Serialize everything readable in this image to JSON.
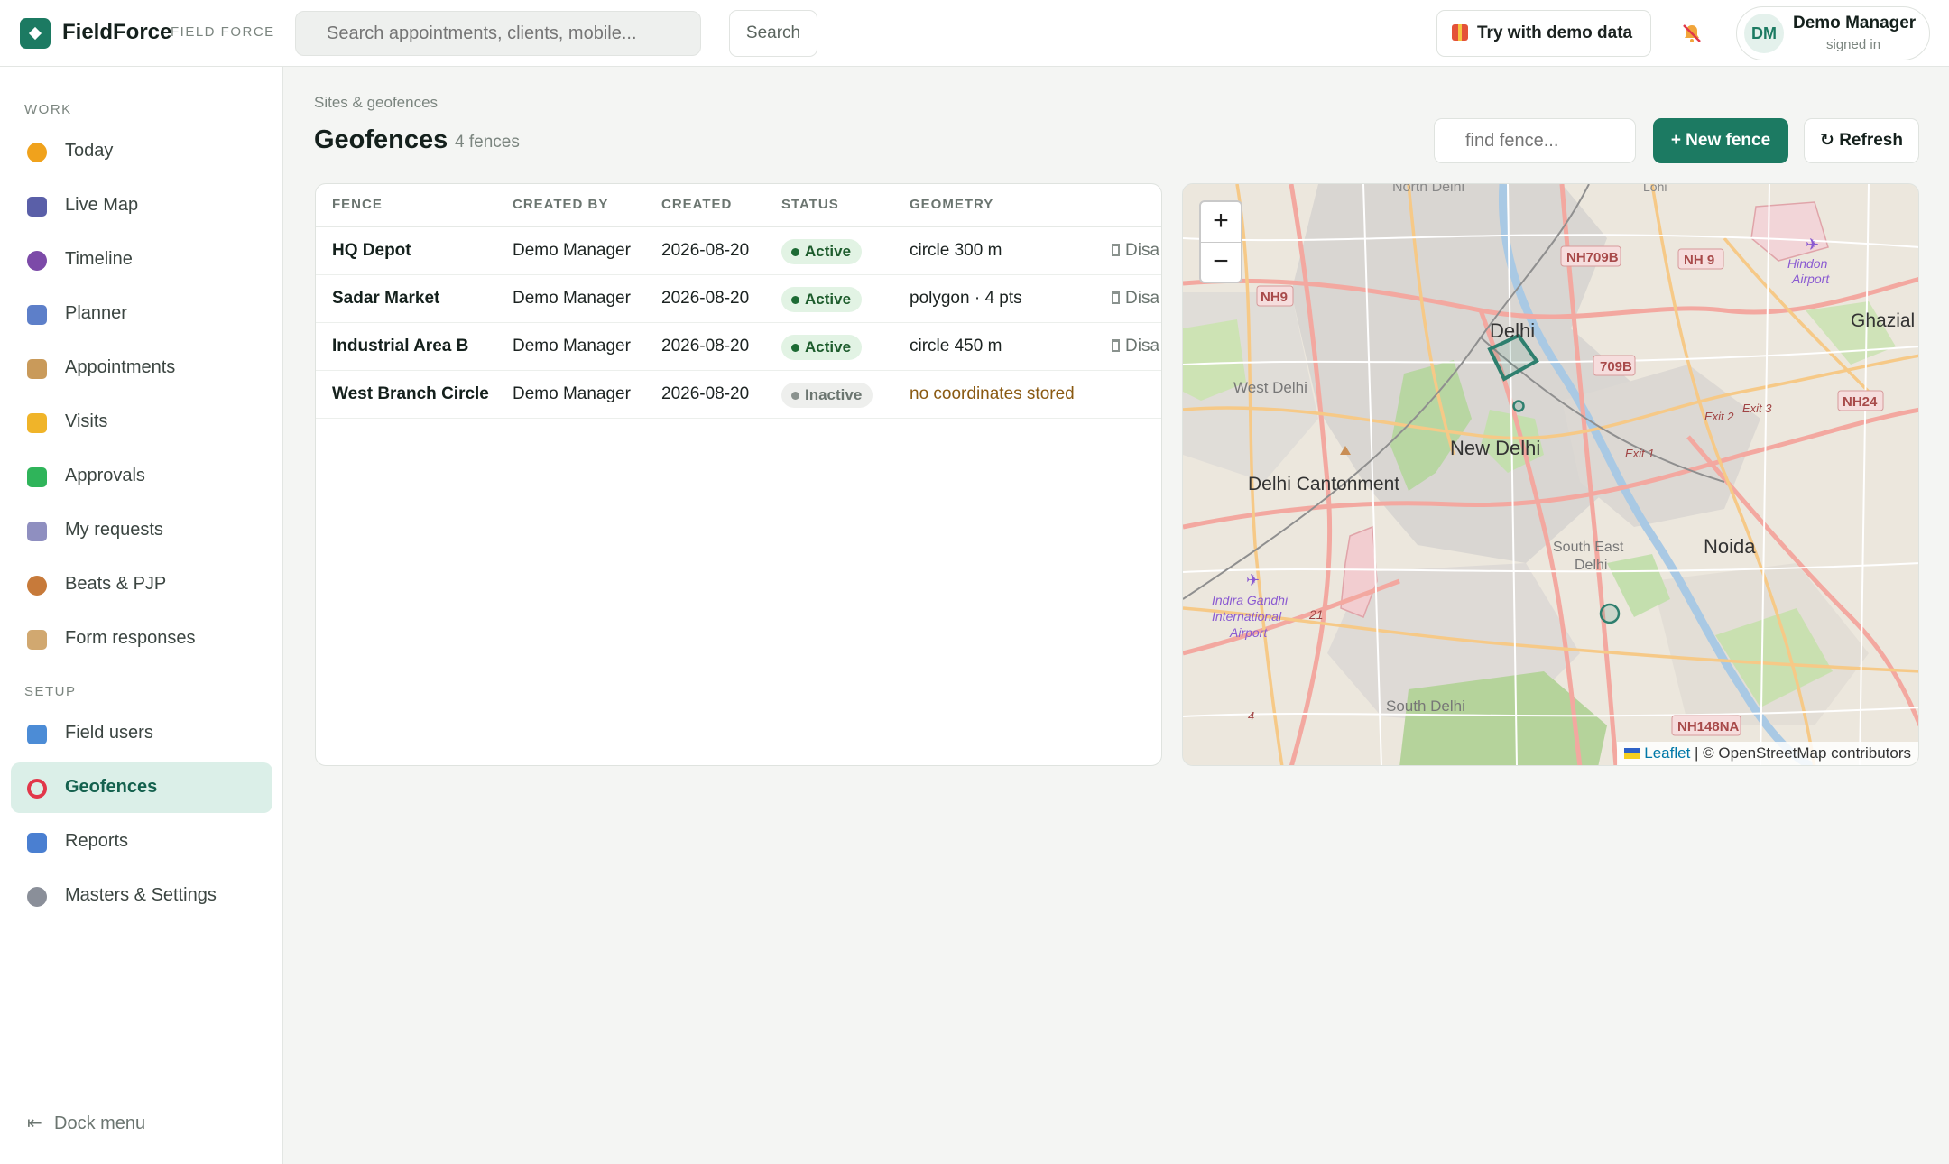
{
  "header": {
    "brand": "FieldForce",
    "brand_sub": "FIELD FORCE",
    "search_placeholder": "Search appointments, clients, mobile...",
    "search_button": "Search",
    "demo_button": "Try with demo data",
    "user_initials": "DM",
    "user_name": "Demo Manager",
    "user_status": "signed in"
  },
  "sidebar": {
    "work_label": "WORK",
    "setup_label": "SETUP",
    "work_items": [
      {
        "label": "Today",
        "icon": "sun-icon",
        "color": "#f0a21c"
      },
      {
        "label": "Live Map",
        "icon": "satellite-icon",
        "color": "#5a5fa8"
      },
      {
        "label": "Timeline",
        "icon": "stopwatch-icon",
        "color": "#7c4aa8"
      },
      {
        "label": "Planner",
        "icon": "calendar-icon",
        "color": "#5d7fc9"
      },
      {
        "label": "Appointments",
        "icon": "clipboard-icon",
        "color": "#c99a5a"
      },
      {
        "label": "Visits",
        "icon": "handshake-icon",
        "color": "#f0b429"
      },
      {
        "label": "Approvals",
        "icon": "check-box-icon",
        "color": "#2fb45a"
      },
      {
        "label": "My requests",
        "icon": "receipt-icon",
        "color": "#8f8fc0"
      },
      {
        "label": "Beats & PJP",
        "icon": "compass-icon",
        "color": "#c77a3a"
      },
      {
        "label": "Form responses",
        "icon": "clipboard-icon",
        "color": "#d1a870"
      }
    ],
    "setup_items": [
      {
        "label": "Field users",
        "icon": "id-card-icon",
        "color": "#4c8cd6"
      },
      {
        "label": "Geofences",
        "icon": "ring-icon",
        "color": "#e2374a"
      },
      {
        "label": "Reports",
        "icon": "bar-chart-icon",
        "color": "#4a7fd1"
      },
      {
        "label": "Masters & Settings",
        "icon": "gear-icon",
        "color": "#8a8f99"
      }
    ],
    "dock_label": "Dock menu"
  },
  "main": {
    "breadcrumb": "Sites & geofences",
    "title": "Geofences",
    "count": "4 fences",
    "find_placeholder": "find fence...",
    "new_button": "+ New fence",
    "refresh_button": "↻ Refresh",
    "columns": [
      "FENCE",
      "CREATED BY",
      "CREATED",
      "STATUS",
      "GEOMETRY"
    ],
    "rows": [
      {
        "fence": "HQ Depot",
        "created_by": "Demo Manager",
        "created": "2026-08-20",
        "status": "Active",
        "geometry": "circle 300 m",
        "action": "Disa"
      },
      {
        "fence": "Sadar Market",
        "created_by": "Demo Manager",
        "created": "2026-08-20",
        "status": "Active",
        "geometry": "polygon · 4 pts",
        "action": "Disa"
      },
      {
        "fence": "Industrial Area B",
        "created_by": "Demo Manager",
        "created": "2026-08-20",
        "status": "Active",
        "geometry": "circle 450 m",
        "action": "Disa"
      },
      {
        "fence": "West Branch Circle",
        "created_by": "Demo Manager",
        "created": "2026-08-20",
        "status": "Inactive",
        "geometry": "no coordinates stored",
        "action": ""
      }
    ]
  },
  "map": {
    "zoom_in": "+",
    "zoom_out": "−",
    "labels": {
      "north_delhi": "North Delhi",
      "delhi": "Delhi",
      "new_delhi": "New Delhi",
      "west_delhi": "West Delhi",
      "delhi_cantonment": "Delhi Cantonment",
      "noida": "Noida",
      "ghazial": "Ghazial",
      "south_east_delhi_1": "South East",
      "south_east_delhi_2": "Delhi",
      "south_delhi": "South Delhi",
      "hindon_1": "Hindon",
      "hindon_2": "Airport",
      "igi_1": "Indira Gandhi",
      "igi_2": "International",
      "igi_3": "Airport",
      "exit_1": "Exit 1",
      "exit_2": "Exit 2",
      "exit_3": "Exit 3",
      "num_21": "21",
      "num_4": "4",
      "lohi": "Lohi",
      "delhi_small": "Delhi"
    },
    "shields": [
      "NH709B",
      "NH 9",
      "NH9",
      "709B",
      "NH24",
      "NH148NA"
    ],
    "attribution_link": "Leaflet",
    "attribution_text": "| © OpenStreetMap contributors",
    "accent": "#1c7a62"
  }
}
